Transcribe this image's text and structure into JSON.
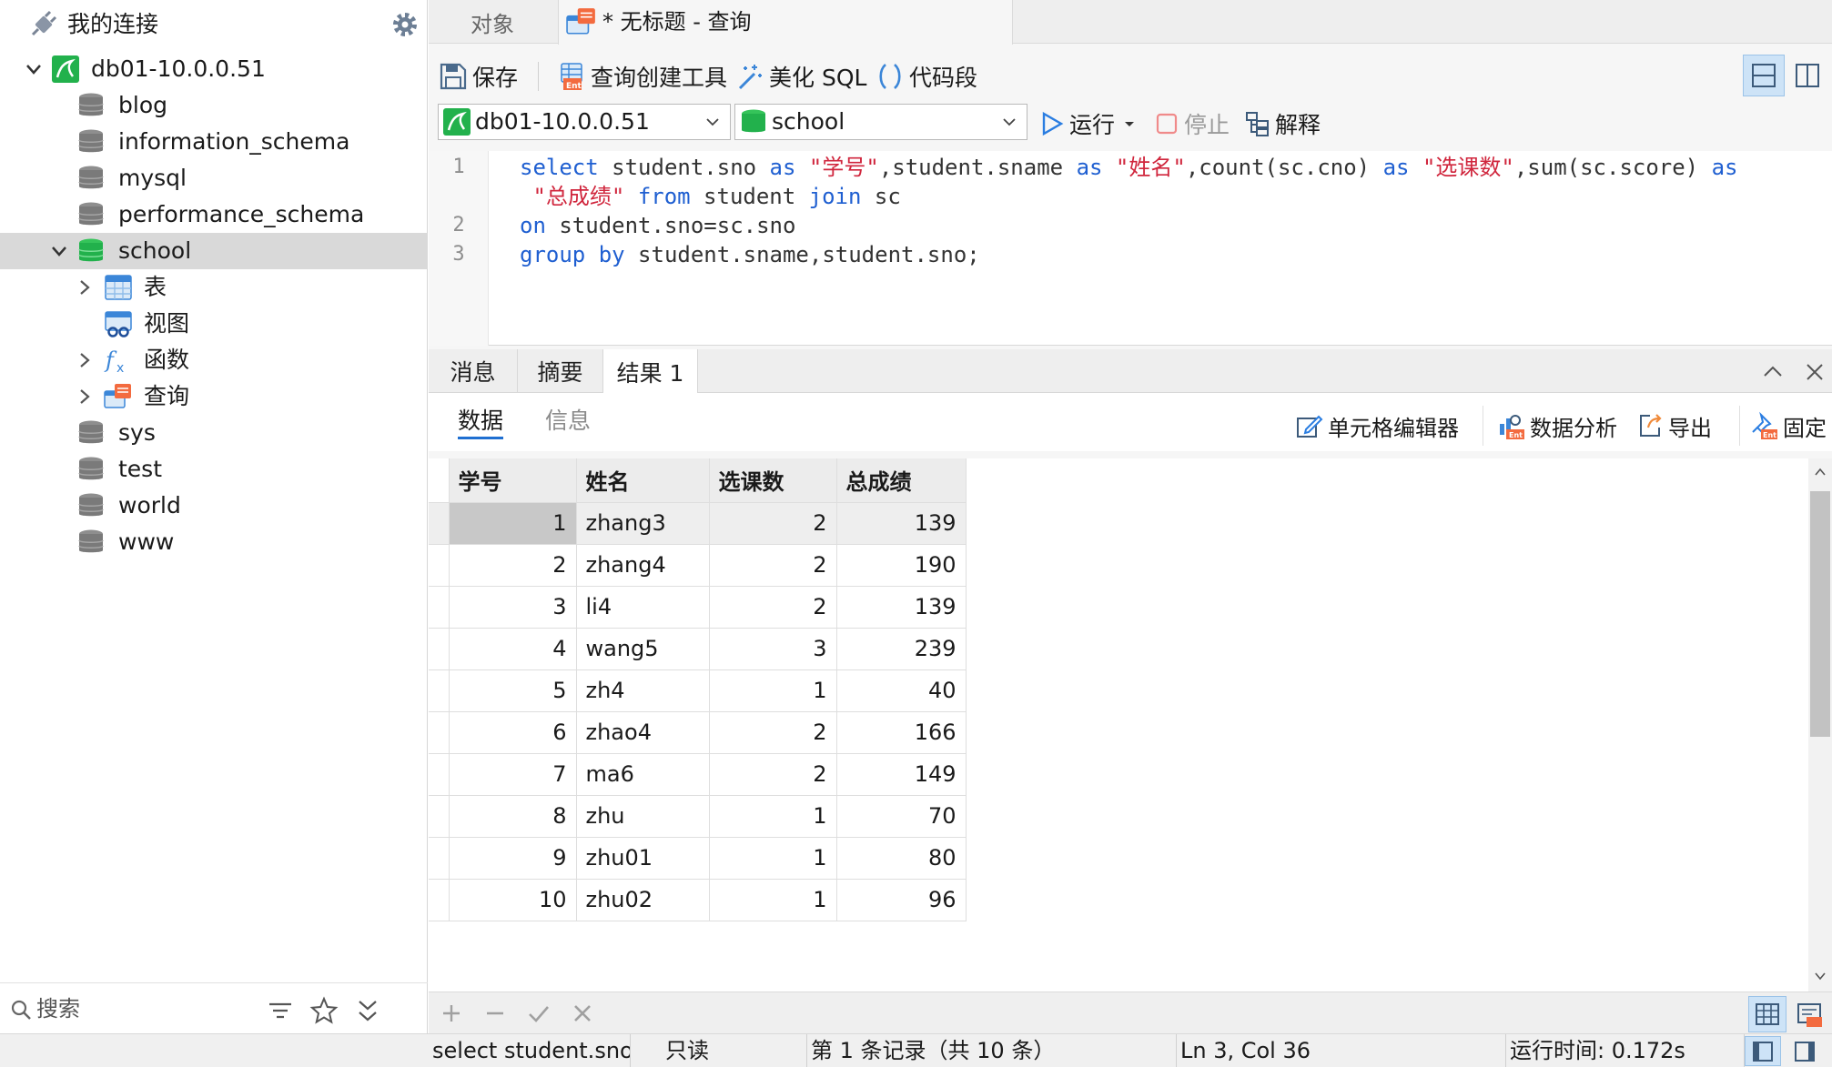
{
  "sidebar": {
    "title": "我的连接",
    "connection": "db01-10.0.0.51",
    "databases": [
      "blog",
      "information_schema",
      "mysql",
      "performance_schema"
    ],
    "selected_db": "school",
    "school_children": [
      "表",
      "视图",
      "函数",
      "查询"
    ],
    "databases_after": [
      "sys",
      "test",
      "world",
      "www"
    ],
    "search_label": "搜索"
  },
  "tabs": {
    "objects": "对象",
    "query": "* 无标题 - 查询"
  },
  "toolbar": {
    "save": "保存",
    "query_builder": "查询创建工具",
    "beautify": "美化 SQL",
    "snippet": "代码段"
  },
  "selectors": {
    "connection": "db01-10.0.0.51",
    "database": "school",
    "run": "运行",
    "stop": "停止",
    "explain": "解释"
  },
  "editor": {
    "line_numbers": [
      "1",
      "2",
      "3"
    ],
    "lines": [
      [
        [
          "kw",
          "select"
        ],
        [
          "txt",
          " student.sno "
        ],
        [
          "kw",
          "as"
        ],
        [
          "txt",
          " "
        ],
        [
          "str",
          "\"学号\""
        ],
        [
          "txt",
          ",student.sname "
        ],
        [
          "kw",
          "as"
        ],
        [
          "txt",
          " "
        ],
        [
          "str",
          "\"姓名\""
        ],
        [
          "txt",
          ",count(sc.cno) "
        ],
        [
          "kw",
          "as"
        ],
        [
          "txt",
          " "
        ],
        [
          "str",
          "\"选课数\""
        ],
        [
          "txt",
          ",sum(sc.score) "
        ],
        [
          "kw",
          "as"
        ]
      ],
      [
        [
          "txt",
          " "
        ],
        [
          "str",
          "\"总成绩\""
        ],
        [
          "txt",
          " "
        ],
        [
          "kw",
          "from"
        ],
        [
          "txt",
          " student "
        ],
        [
          "kw",
          "join"
        ],
        [
          "txt",
          " sc"
        ]
      ],
      [
        [
          "kw",
          "on"
        ],
        [
          "txt",
          " student.sno=sc.sno"
        ]
      ],
      [
        [
          "kw",
          "group by"
        ],
        [
          "txt",
          " student.sname,student.sno;"
        ]
      ]
    ]
  },
  "result_tabs": [
    "消息",
    "摘要",
    "结果 1"
  ],
  "subtabs": {
    "data": "数据",
    "info": "信息",
    "cell_editor": "单元格编辑器",
    "analysis": "数据分析",
    "export": "导出",
    "pin": "固定"
  },
  "grid": {
    "columns": [
      "学号",
      "姓名",
      "选课数",
      "总成绩"
    ],
    "rows": [
      [
        "1",
        "zhang3",
        "2",
        "139"
      ],
      [
        "2",
        "zhang4",
        "2",
        "190"
      ],
      [
        "3",
        "li4",
        "2",
        "139"
      ],
      [
        "4",
        "wang5",
        "3",
        "239"
      ],
      [
        "5",
        "zh4",
        "1",
        "40"
      ],
      [
        "6",
        "zhao4",
        "2",
        "166"
      ],
      [
        "7",
        "ma6",
        "2",
        "149"
      ],
      [
        "8",
        "zhu",
        "1",
        "70"
      ],
      [
        "9",
        "zhu01",
        "1",
        "80"
      ],
      [
        "10",
        "zhu02",
        "1",
        "96"
      ]
    ]
  },
  "status": {
    "query_preview": "select student.sno ؛",
    "mode": "只读",
    "record": "第 1 条记录（共 10 条）",
    "cursor": "Ln 3, Col 36",
    "runtime": "运行时间: 0.172s"
  },
  "colors": {
    "accent": "#1f6fd1",
    "keyword": "#1f5fd1",
    "string": "#d0263d",
    "db_green": "#22b14c",
    "selected_row": "#d9d9d9"
  }
}
